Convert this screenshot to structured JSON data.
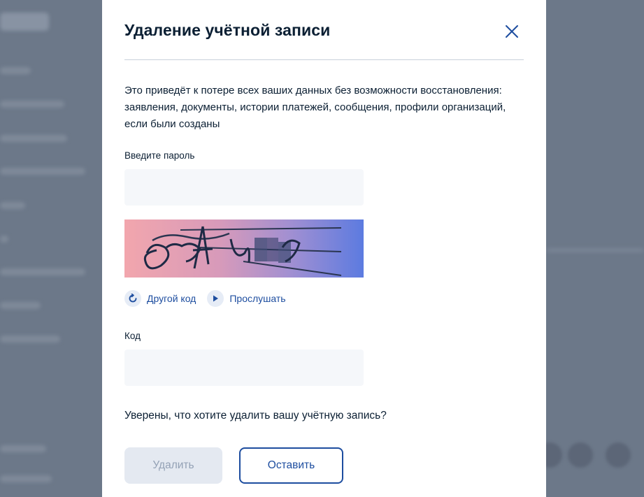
{
  "modal": {
    "title": "Удаление учётной записи",
    "warning": "Это приведёт к потере всех ваших данных без возможности восстановления: заявления, документы, истории платежей, сообщения, профили организаций, если были созданы",
    "password_label": "Введите пароль",
    "password_value": "",
    "captcha_refresh_label": "Другой код",
    "captcha_listen_label": "Прослушать",
    "code_label": "Код",
    "code_value": "",
    "question": "Уверены, что хотите удалить вашу учётную запись?",
    "delete_label": "Удалить",
    "keep_label": "Оставить"
  },
  "colors": {
    "accent": "#1d4d9f",
    "text": "#0b1f33",
    "input_bg": "#f5f7fa",
    "disabled_bg": "#e4e9f1"
  }
}
